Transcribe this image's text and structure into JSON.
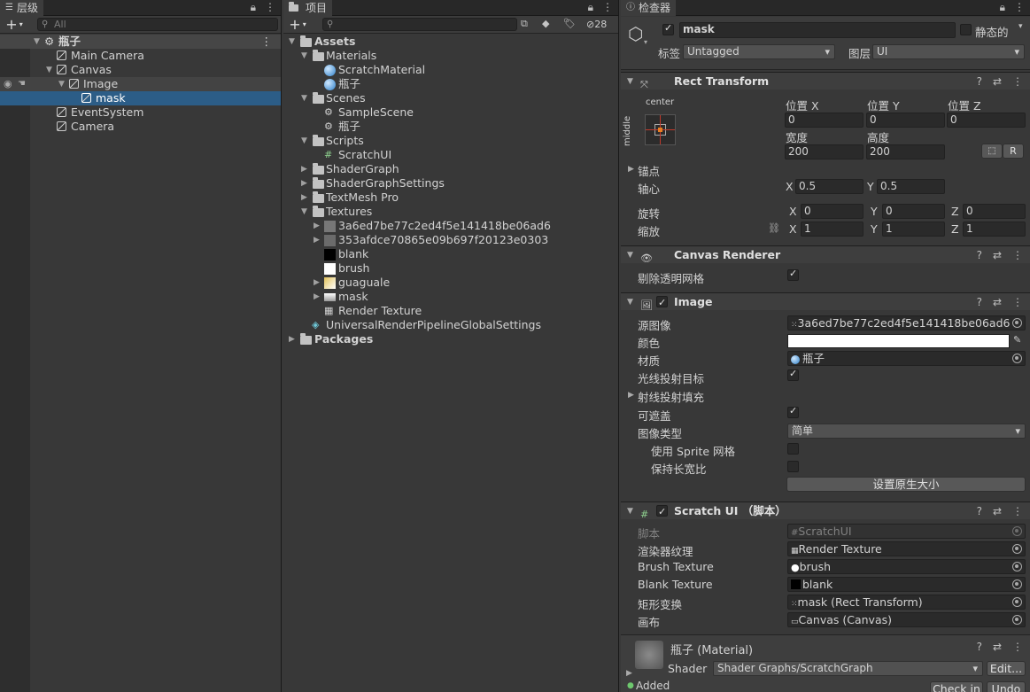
{
  "hierarchy": {
    "tab_label": "层级",
    "search_placeholder": "All",
    "root": "瓶子",
    "items": [
      "Main Camera",
      "Canvas",
      "Image",
      "mask",
      "EventSystem",
      "Camera"
    ]
  },
  "project": {
    "tab_label": "项目",
    "hidden_count": "28",
    "items": [
      "Assets",
      "Materials",
      "ScratchMaterial",
      "瓶子",
      "Scenes",
      "SampleScene",
      "瓶子",
      "Scripts",
      "ScratchUI",
      "ShaderGraph",
      "ShaderGraphSettings",
      "TextMesh Pro",
      "Textures",
      "3a6ed7be77c2ed4f5e141418be06ad6",
      "353afdce70865e09b697f20123e0303",
      "blank",
      "brush",
      "guaguale",
      "mask",
      "Render Texture",
      "UniversalRenderPipelineGlobalSettings",
      "Packages"
    ]
  },
  "inspector": {
    "tab_label": "检查器",
    "object_name": "mask",
    "static_label": "静态的",
    "tag_label": "标签",
    "tag_value": "Untagged",
    "layer_label": "图层",
    "layer_value": "UI",
    "rect_transform": {
      "title": "Rect Transform",
      "anchor_h": "center",
      "anchor_v": "middle",
      "pos_x_label": "位置 X",
      "pos_y_label": "位置 Y",
      "pos_z_label": "位置 Z",
      "pos_x": "0",
      "pos_y": "0",
      "pos_z": "0",
      "width_label": "宽度",
      "height_label": "高度",
      "width": "200",
      "height": "200",
      "r_button": "R",
      "anchors_label": "锚点",
      "pivot_label": "轴心",
      "pivot_x": "0.5",
      "pivot_y": "0.5",
      "rotation_label": "旋转",
      "rot_x": "0",
      "rot_y": "0",
      "rot_z": "0",
      "scale_label": "缩放",
      "scale_x": "1",
      "scale_y": "1",
      "scale_z": "1",
      "x": "X",
      "y": "Y",
      "z": "Z"
    },
    "canvas_renderer": {
      "title": "Canvas Renderer",
      "cull_label": "剔除透明网格"
    },
    "image": {
      "title": "Image",
      "source_label": "源图像",
      "source_value": "3a6ed7be77c2ed4f5e141418be06ad6",
      "color_label": "颜色",
      "material_label": "材质",
      "material_value": "瓶子",
      "raycast_label": "光线投射目标",
      "raycast_padding_label": "射线投射填充",
      "maskable_label": "可遮盖",
      "type_label": "图像类型",
      "type_value": "简单",
      "sprite_mesh_label": "使用 Sprite 网格",
      "preserve_label": "保持长宽比",
      "native_button": "设置原生大小"
    },
    "scratch_ui": {
      "title": "Scratch UI （脚本）",
      "script_label": "脚本",
      "script_value": "ScratchUI",
      "rt_label": "渲染器纹理",
      "rt_value": "Render Texture",
      "brush_label": "Brush Texture",
      "brush_value": "brush",
      "blank_label": "Blank Texture",
      "blank_value": "blank",
      "rect_label": "矩形变换",
      "rect_value": "mask (Rect Transform)",
      "canvas_label": "画布",
      "canvas_value": "Canvas (Canvas)"
    },
    "material": {
      "name": "瓶子 (Material)",
      "shader_label": "Shader",
      "shader_value": "Shader Graphs/ScratchGraph",
      "edit_button": "Edit...",
      "added_label": "Added",
      "checkin_button": "Check in",
      "undo_button": "Undo"
    }
  }
}
